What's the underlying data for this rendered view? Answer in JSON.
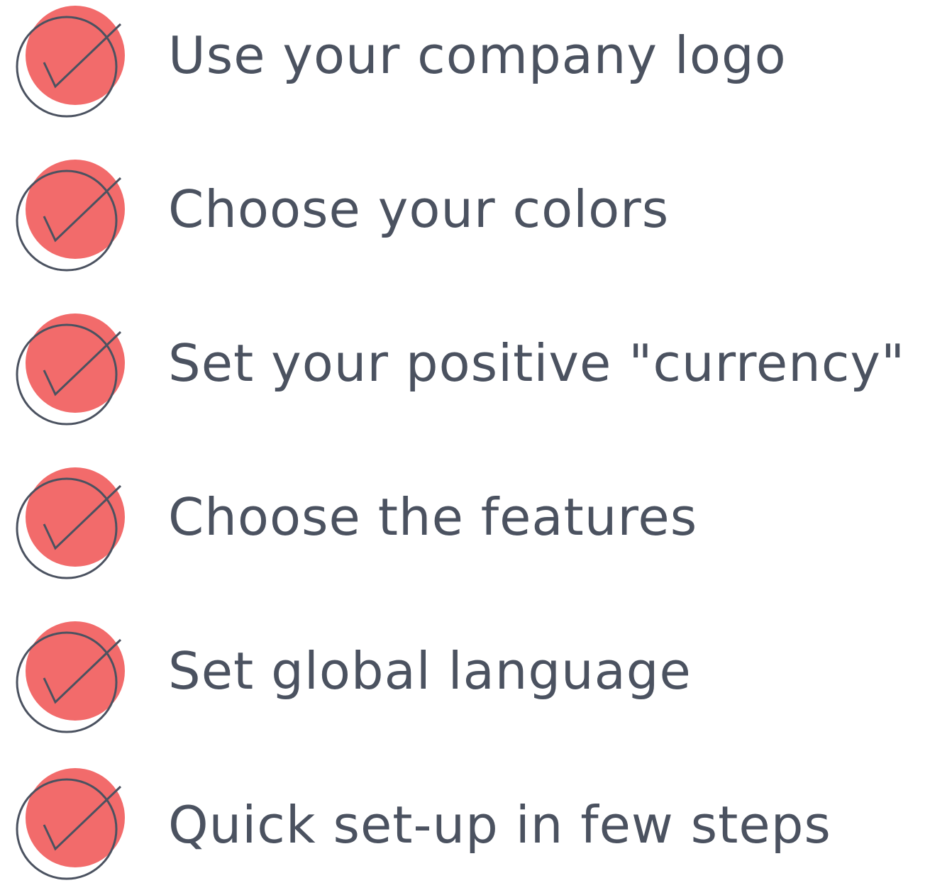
{
  "colors": {
    "accent": "#f26b6b",
    "outline": "#4b5260",
    "text": "#4b5260",
    "background": "#ffffff"
  },
  "checklist": {
    "icon": "check-circle-icon",
    "items": [
      {
        "label": "Use your company logo"
      },
      {
        "label": "Choose your colors"
      },
      {
        "label": "Set your positive \"currency\""
      },
      {
        "label": "Choose the features"
      },
      {
        "label": "Set global language"
      },
      {
        "label": "Quick set-up in few steps"
      }
    ]
  }
}
